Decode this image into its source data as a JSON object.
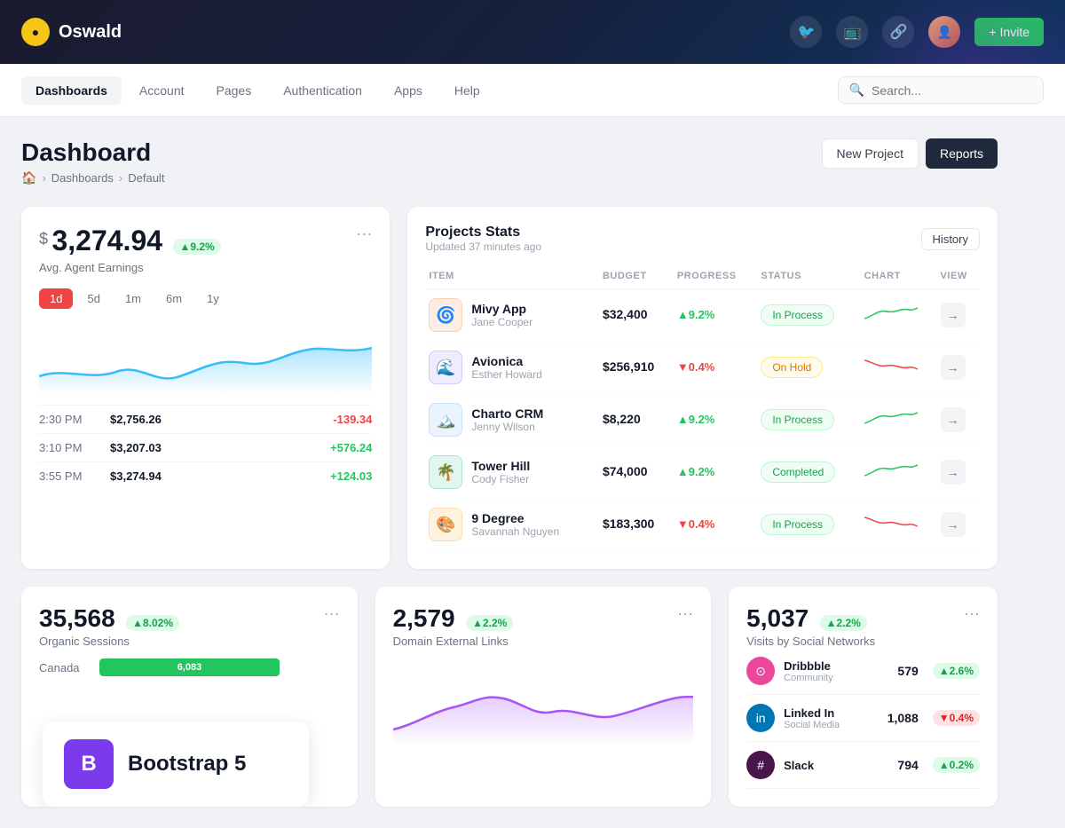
{
  "app": {
    "logo_text": "Oswald",
    "invite_label": "+ Invite"
  },
  "top_nav": {
    "icons": [
      "🐦",
      "📺",
      "🔗"
    ]
  },
  "sec_nav": {
    "items": [
      {
        "id": "dashboards",
        "label": "Dashboards",
        "active": true
      },
      {
        "id": "account",
        "label": "Account",
        "active": false
      },
      {
        "id": "pages",
        "label": "Pages",
        "active": false
      },
      {
        "id": "authentication",
        "label": "Authentication",
        "active": false
      },
      {
        "id": "apps",
        "label": "Apps",
        "active": false
      },
      {
        "id": "help",
        "label": "Help",
        "active": false
      }
    ],
    "search_placeholder": "Search..."
  },
  "page_header": {
    "title": "Dashboard",
    "breadcrumb": [
      "🏠",
      "Dashboards",
      "Default"
    ],
    "btn_new_project": "New Project",
    "btn_reports": "Reports"
  },
  "earnings_card": {
    "dollar_sign": "$",
    "amount": "3,274.94",
    "badge": "▲9.2%",
    "label": "Avg. Agent Earnings",
    "more": "···",
    "time_filters": [
      "1d",
      "5d",
      "1m",
      "6m",
      "1y"
    ],
    "active_filter": "1d",
    "rows": [
      {
        "time": "2:30 PM",
        "amount": "$2,756.26",
        "change": "-139.34",
        "positive": false
      },
      {
        "time": "3:10 PM",
        "amount": "$3,207.03",
        "change": "+576.24",
        "positive": true
      },
      {
        "time": "3:55 PM",
        "amount": "$3,274.94",
        "change": "+124.03",
        "positive": true
      }
    ]
  },
  "projects_card": {
    "title": "Projects Stats",
    "updated": "Updated 37 minutes ago",
    "history_btn": "History",
    "columns": [
      "Item",
      "Budget",
      "Progress",
      "Status",
      "Chart",
      "View"
    ],
    "rows": [
      {
        "name": "Mivy App",
        "owner": "Jane Cooper",
        "budget": "$32,400",
        "progress": "▲9.2%",
        "progress_up": true,
        "status": "In Process",
        "status_type": "inprocess",
        "thumb_color": "#f97316",
        "thumb_emoji": "🌀"
      },
      {
        "name": "Avionica",
        "owner": "Esther Howard",
        "budget": "$256,910",
        "progress": "▼0.4%",
        "progress_up": false,
        "status": "On Hold",
        "status_type": "onhold",
        "thumb_color": "#8b5cf6",
        "thumb_emoji": "🌊"
      },
      {
        "name": "Charto CRM",
        "owner": "Jenny Wilson",
        "budget": "$8,220",
        "progress": "▲9.2%",
        "progress_up": true,
        "status": "In Process",
        "status_type": "inprocess",
        "thumb_color": "#60a5fa",
        "thumb_emoji": "🏔️"
      },
      {
        "name": "Tower Hill",
        "owner": "Cody Fisher",
        "budget": "$74,000",
        "progress": "▲9.2%",
        "progress_up": true,
        "status": "Completed",
        "status_type": "completed",
        "thumb_color": "#10b981",
        "thumb_emoji": "🌴"
      },
      {
        "name": "9 Degree",
        "owner": "Savannah Nguyen",
        "budget": "$183,300",
        "progress": "▼0.4%",
        "progress_up": false,
        "status": "In Process",
        "status_type": "inprocess",
        "thumb_color": "#f59e0b",
        "thumb_emoji": "🎨"
      }
    ]
  },
  "organic_card": {
    "number": "35,568",
    "badge": "▲8.02%",
    "label": "Organic Sessions",
    "more": "···",
    "geo_rows": [
      {
        "name": "Canada",
        "value": "6,083",
        "bar_pct": 75
      }
    ]
  },
  "domain_card": {
    "number": "2,579",
    "badge": "▲2.2%",
    "label": "Domain External Links",
    "more": "···"
  },
  "social_card": {
    "number": "5,037",
    "badge": "▲2.2%",
    "label": "Visits by Social Networks",
    "more": "···",
    "rows": [
      {
        "name": "Dribbble",
        "type": "Community",
        "count": "579",
        "change": "▲2.6%",
        "up": true,
        "color": "#ea4899"
      },
      {
        "name": "Linked In",
        "type": "Social Media",
        "count": "1,088",
        "change": "▼0.4%",
        "up": false,
        "color": "#0077b5"
      },
      {
        "name": "Slack",
        "type": "",
        "count": "794",
        "change": "▲0.2%",
        "up": true,
        "color": "#4a154b"
      }
    ]
  },
  "bootstrap_overlay": {
    "icon": "B",
    "text": "Bootstrap 5"
  }
}
